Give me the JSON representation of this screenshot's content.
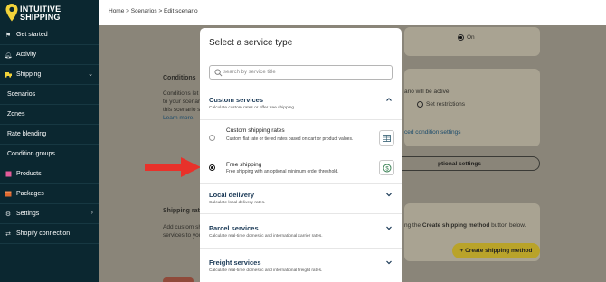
{
  "brand": {
    "line1": "INTUITIVE",
    "line2": "SHIPPING"
  },
  "sidebar": {
    "items": [
      {
        "label": "Get started",
        "icon": "flag-icon"
      },
      {
        "label": "Activity",
        "icon": "bell-icon"
      },
      {
        "label": "Shipping",
        "icon": "truck-icon"
      },
      {
        "label": "Scenarios"
      },
      {
        "label": "Zones"
      },
      {
        "label": "Rate blending"
      },
      {
        "label": "Condition groups"
      },
      {
        "label": "Products",
        "icon": "box-icon"
      },
      {
        "label": "Packages",
        "icon": "package-icon"
      },
      {
        "label": "Settings",
        "icon": "gear-icon"
      },
      {
        "label": "Shopify connection",
        "icon": "link-icon"
      }
    ]
  },
  "breadcrumb": "Home > Scenarios > Edit scenario",
  "background": {
    "on_label": "On",
    "conditions_heading": "Conditions",
    "conditions_text_1": "Conditions let y",
    "conditions_text_2": "to your scenari",
    "conditions_text_3": "this scenario sh",
    "learn_more": "Learn more.",
    "will_be_active": "ario will be active.",
    "set_restrictions": "Set restrictions",
    "condition_settings_link": "ced condition settings",
    "optional_settings_btn": "ptional settings",
    "shipping_rates_heading": "Shipping rat",
    "add_custom_1": "Add custom sh",
    "add_custom_2": "services to you",
    "create_hint_pre": "ng the ",
    "create_hint_bold": "Create shipping method",
    "create_hint_post": " button below.",
    "create_btn": "+ Create shipping method"
  },
  "modal": {
    "title": "Select a service type",
    "search_placeholder": "search by service title",
    "sections": [
      {
        "title": "Custom services",
        "subtitle": "Calculate custom rates or offer free shipping.",
        "expanded": true
      },
      {
        "title": "Local delivery",
        "subtitle": "Calculate local delivery rates."
      },
      {
        "title": "Parcel services",
        "subtitle": "Calculate real-time domestic and international carrier rates."
      },
      {
        "title": "Freight services",
        "subtitle": "Calculate real-time domestic and international freight rates."
      }
    ],
    "options": [
      {
        "title": "Custom shipping rates",
        "description": "Custom flat rate or tiered rates based on cart or product values.",
        "selected": false,
        "icon": "table-icon"
      },
      {
        "title": "Free shipping",
        "description": "Free shipping with an optional minimum order threshold.",
        "selected": true,
        "icon": "dollar-cycle-icon"
      }
    ]
  },
  "colors": {
    "sidebar": "#0b2730",
    "accent_yellow": "#f2d33a",
    "arrow": "#e8312a",
    "section_title": "#1b3a57"
  }
}
